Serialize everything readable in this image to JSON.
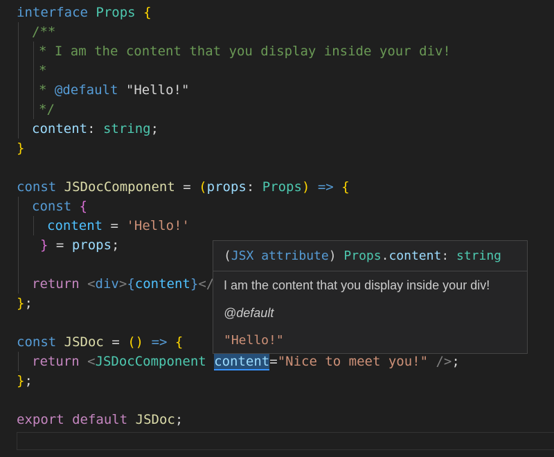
{
  "code": {
    "l1": {
      "kw": "interface",
      "name": "Props",
      "brace": "{"
    },
    "l2": {
      "c": "/**"
    },
    "l3": {
      "c": "* I am the content that you display inside your div!"
    },
    "l4": {
      "c": "*"
    },
    "l5": {
      "star": "*",
      "tag": "@default",
      "val": "\"Hello!\""
    },
    "l6": {
      "c": "*/"
    },
    "l7": {
      "prop": "content",
      "colon": ":",
      "type": "string",
      "semi": ";"
    },
    "l8": {
      "brace": "}"
    },
    "l9": {
      "kw": "const",
      "name": "JSDocComponent",
      "eq": "=",
      "open": "(",
      "param": "props",
      "colon": ":",
      "type": "Props",
      "close": ")",
      "arrow": "=>",
      "brace": "{"
    },
    "l10": {
      "kw": "const",
      "brace": "{"
    },
    "l11": {
      "prop": "content",
      "eq": "=",
      "str": "'Hello!'"
    },
    "l12": {
      "brace": "}",
      "eq": "=",
      "var": "props",
      "semi": ";"
    },
    "l14": {
      "kw": "return",
      "lt": "<",
      "tag": "div",
      "gt": ">",
      "ob": "{",
      "var": "content",
      "cb": "}",
      "end": "</"
    },
    "l15": {
      "brace": "}",
      "semi": ";"
    },
    "l16": {
      "kw": "const",
      "name": "JSDoc",
      "eq": "=",
      "paren": "()",
      "arrow": "=>",
      "brace": "{"
    },
    "l17": {
      "kw": "return",
      "lt": "<",
      "comp": "JSDocComponent",
      "attr": "content",
      "eq": "=",
      "str": "\"Nice to meet you!\"",
      "end": "/>",
      "semi": ";"
    },
    "l18": {
      "brace": "}",
      "semi": ";"
    },
    "l19": {
      "kw1": "export",
      "kw2": "default",
      "name": "JSDoc",
      "semi": ";"
    }
  },
  "hover": {
    "signature_open": "(",
    "signature_kind": "JSX attribute",
    "signature_close": ")",
    "signature_owner": "Props",
    "signature_dot": ".",
    "signature_prop": "content",
    "signature_colon": ":",
    "signature_type": "string",
    "description": "I am the content that you display inside your div!",
    "tag": "@default",
    "default_value": "\"Hello!\""
  }
}
